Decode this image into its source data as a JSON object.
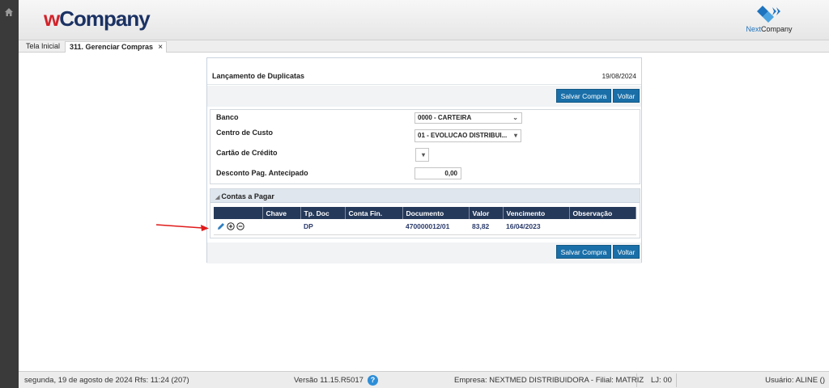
{
  "header": {
    "brand_w": "w",
    "brand_rest": "Company",
    "partner_brand_a": "Next",
    "partner_brand_b": "Company"
  },
  "tabs": [
    {
      "label": "Tela Inicial"
    },
    {
      "label": "311. Gerenciar Compras",
      "close": "×"
    }
  ],
  "panel": {
    "title": "Lançamento de Duplicatas",
    "date": "19/08/2024",
    "save_label": "Salvar Compra",
    "back_label": "Voltar"
  },
  "form": {
    "banco_label": "Banco",
    "banco_value": "0000 - CARTEIRA",
    "centro_label": "Centro de Custo",
    "centro_value": "01 - EVOLUCAO DISTRIBUI...",
    "cartao_label": "Cartão de Crédito",
    "cartao_value": "",
    "desconto_label": "Desconto Pag. Antecipado",
    "desconto_value": "0,00"
  },
  "grid": {
    "title": "Contas a Pagar",
    "columns": [
      "",
      "Chave",
      "Tp. Doc",
      "Conta Fin.",
      "Documento",
      "Valor",
      "Vencimento",
      "Observação"
    ],
    "rows": [
      {
        "chave": "",
        "tp_doc": "DP",
        "conta_fin": "",
        "documento": "470000012/01",
        "valor": "83,82",
        "vencimento": "16/04/2023",
        "observacao": ""
      }
    ]
  },
  "status": {
    "datetime": "segunda, 19 de agosto de 2024  Rfs: 11:24 (207)",
    "version": "Versão 11.15.R5017",
    "help": "?",
    "empresa": "Empresa: NEXTMED DISTRIBUIDORA - Filial: MATRIZ",
    "lj": "LJ: 00",
    "usuario": "Usuário: ALINE ()"
  },
  "colors": {
    "accent": "#1a6fa8",
    "table_header": "#25395a",
    "brand_red": "#d2232a",
    "brand_blue": "#1b3263"
  }
}
